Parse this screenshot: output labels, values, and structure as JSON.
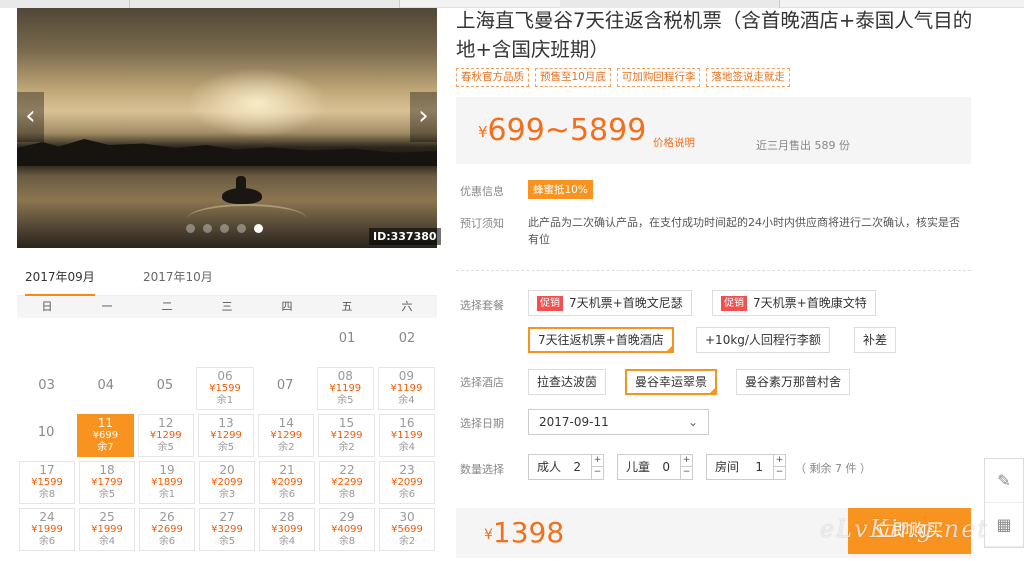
{
  "product": {
    "title": "上海直飞曼谷7天往返含税机票（含首晚酒店+泰国人气目的地+含国庆班期）",
    "tags": [
      "春秋官方品质",
      "预售至10月底",
      "可加购回程行李",
      "落地签说走就走"
    ],
    "price_prefix": "¥",
    "price_range": "699~5899",
    "price_note": "价格说明",
    "sold": "近三月售出 589 份"
  },
  "gallery": {
    "prev_icon": "‹",
    "next_icon": "›",
    "image_id": "ID:337380",
    "dots": 5,
    "active_dot": 5
  },
  "calendar": {
    "months": [
      "2017年09月",
      "2017年10月"
    ],
    "weekdays": [
      "日",
      "一",
      "二",
      "三",
      "四",
      "五",
      "六"
    ],
    "rows": [
      [
        {
          "d": ""
        },
        {
          "d": ""
        },
        {
          "d": ""
        },
        {
          "d": ""
        },
        {
          "d": ""
        },
        {
          "d": "01"
        },
        {
          "d": "02"
        }
      ],
      [
        {
          "d": "03"
        },
        {
          "d": "04"
        },
        {
          "d": "05"
        },
        {
          "d": "06",
          "p": "¥1599",
          "r": "余1"
        },
        {
          "d": "07"
        },
        {
          "d": "08",
          "p": "¥1199",
          "r": "余5"
        },
        {
          "d": "09",
          "p": "¥1199",
          "r": "余4"
        }
      ],
      [
        {
          "d": "10"
        },
        {
          "d": "11",
          "p": "¥699",
          "r": "余7",
          "sel": true
        },
        {
          "d": "12",
          "p": "¥1299",
          "r": "余5"
        },
        {
          "d": "13",
          "p": "¥1299",
          "r": "余5"
        },
        {
          "d": "14",
          "p": "¥1299",
          "r": "余2"
        },
        {
          "d": "15",
          "p": "¥1299",
          "r": "余2"
        },
        {
          "d": "16",
          "p": "¥1199",
          "r": "余4"
        }
      ],
      [
        {
          "d": "17",
          "p": "¥1599",
          "r": "余8"
        },
        {
          "d": "18",
          "p": "¥1799",
          "r": "余5"
        },
        {
          "d": "19",
          "p": "¥1899",
          "r": "余1"
        },
        {
          "d": "20",
          "p": "¥2099",
          "r": "余3"
        },
        {
          "d": "21",
          "p": "¥2099",
          "r": "余6"
        },
        {
          "d": "22",
          "p": "¥2299",
          "r": "余8"
        },
        {
          "d": "23",
          "p": "¥2099",
          "r": "余6"
        }
      ],
      [
        {
          "d": "24",
          "p": "¥1999",
          "r": "余6"
        },
        {
          "d": "25",
          "p": "¥1999",
          "r": "余4"
        },
        {
          "d": "26",
          "p": "¥2699",
          "r": "余6"
        },
        {
          "d": "27",
          "p": "¥3299",
          "r": "余5"
        },
        {
          "d": "28",
          "p": "¥3099",
          "r": "余4"
        },
        {
          "d": "29",
          "p": "¥4099",
          "r": "余8"
        },
        {
          "d": "30",
          "p": "¥5699",
          "r": "余2"
        }
      ]
    ]
  },
  "info": {
    "discount_label": "优惠信息",
    "discount_badge": "蜂蜜抵10%",
    "notice_label": "预订须知",
    "notice_text": "此产品为二次确认产品，在支付成功时间起的24小时内供应商将进行二次确认，核实是否有位"
  },
  "package": {
    "label": "选择套餐",
    "promo": "促销",
    "options": [
      "7天机票+首晚文尼瑟",
      "7天机票+首晚康文特",
      "7天往返机票+首晚酒店",
      "+10kg/人回程行李额",
      "补差"
    ]
  },
  "hotel": {
    "label": "选择酒店",
    "options": [
      "拉查达波茵",
      "曼谷幸运翠景",
      "曼谷素万那普村舍"
    ]
  },
  "date": {
    "label": "选择日期",
    "value": "2017-09-11",
    "chevron": "⌄"
  },
  "quantity": {
    "label": "数量选择",
    "steppers": [
      {
        "name": "成人",
        "value": "2"
      },
      {
        "name": "儿童",
        "value": "0"
      },
      {
        "name": "房间",
        "value": "1"
      }
    ],
    "plus": "+",
    "minus": "−",
    "remaining": "（ 剩余 7 件 ）"
  },
  "buy": {
    "currency": "¥",
    "total": "1398",
    "button": "立即购买"
  },
  "sidetool": {
    "edit_icon": "✎",
    "qr_icon": "▦"
  },
  "watermark": "eLvKing.net",
  "colors": {
    "accent": "#f7931e",
    "price": "#f2701c",
    "promo": "#f05050"
  }
}
